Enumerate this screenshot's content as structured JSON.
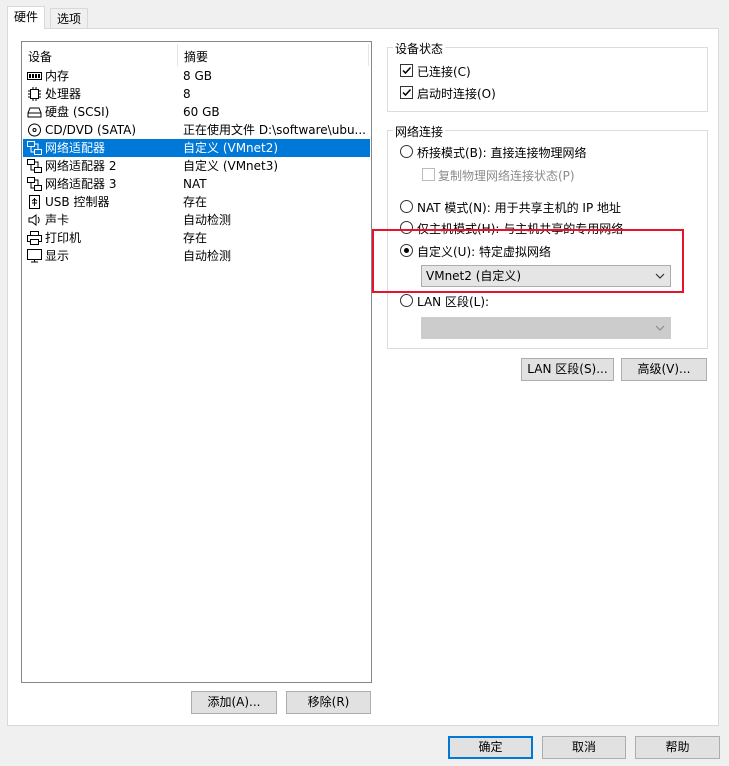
{
  "tabs": [
    {
      "label": "硬件",
      "active": true
    },
    {
      "label": "选项",
      "active": false
    }
  ],
  "device_list": {
    "headers": {
      "device": "设备",
      "summary": "摘要"
    },
    "rows": [
      {
        "name": "内存",
        "summary": "8 GB",
        "icon": "memory-icon",
        "selected": false
      },
      {
        "name": "处理器",
        "summary": "8",
        "icon": "processor-icon",
        "selected": false
      },
      {
        "name": "硬盘 (SCSI)",
        "summary": "60 GB",
        "icon": "hard-disk-icon",
        "selected": false
      },
      {
        "name": "CD/DVD (SATA)",
        "summary": "正在使用文件 D:\\software\\ubu...",
        "icon": "cd-dvd-icon",
        "selected": false
      },
      {
        "name": "网络适配器",
        "summary": "自定义 (VMnet2)",
        "icon": "network-adapter-icon",
        "selected": true
      },
      {
        "name": "网络适配器 2",
        "summary": "自定义 (VMnet3)",
        "icon": "network-adapter-icon",
        "selected": false
      },
      {
        "name": "网络适配器 3",
        "summary": "NAT",
        "icon": "network-adapter-icon",
        "selected": false
      },
      {
        "name": "USB 控制器",
        "summary": "存在",
        "icon": "usb-icon",
        "selected": false
      },
      {
        "name": "声卡",
        "summary": "自动检测",
        "icon": "speaker-icon",
        "selected": false
      },
      {
        "name": "打印机",
        "summary": "存在",
        "icon": "printer-icon",
        "selected": false
      },
      {
        "name": "显示",
        "summary": "自动检测",
        "icon": "monitor-icon",
        "selected": false
      }
    ]
  },
  "list_buttons": {
    "add": "添加(A)...",
    "remove": "移除(R)"
  },
  "device_status": {
    "title": "设备状态",
    "connected": {
      "label": "已连接(C)",
      "checked": true
    },
    "connect_at_power_on": {
      "label": "启动时连接(O)",
      "checked": true
    }
  },
  "network_connection": {
    "title": "网络连接",
    "bridged": {
      "label": "桥接模式(B): 直接连接物理网络",
      "selected": false
    },
    "replicate": {
      "label": "复制物理网络连接状态(P)",
      "checked": false,
      "disabled": true
    },
    "nat": {
      "label": "NAT 模式(N): 用于共享主机的 IP 地址",
      "selected": false
    },
    "host_only": {
      "label": "仅主机模式(H): 与主机共享的专用网络",
      "selected": false
    },
    "custom": {
      "label": "自定义(U): 特定虚拟网络",
      "selected": true
    },
    "custom_value": "VMnet2 (自定义)",
    "lan_segment": {
      "label": "LAN 区段(L):",
      "selected": false
    },
    "lan_segment_value": ""
  },
  "side_buttons": {
    "lan_segments": "LAN 区段(S)...",
    "advanced": "高级(V)..."
  },
  "dialog_buttons": {
    "ok": "确定",
    "cancel": "取消",
    "help": "帮助"
  },
  "colors": {
    "selection": "#0078d7",
    "highlight_box": "#e8132b"
  }
}
